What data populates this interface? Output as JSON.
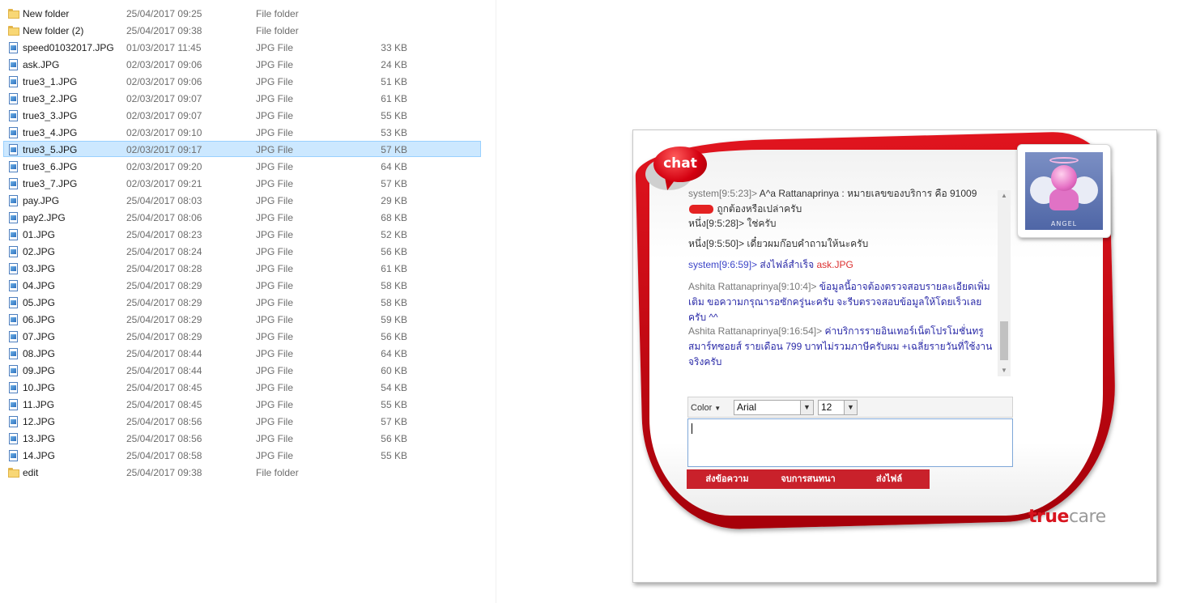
{
  "files": [
    {
      "name": "New folder",
      "date": "25/04/2017 09:25",
      "type": "File folder",
      "size": "",
      "icon": "folder-icon"
    },
    {
      "name": "New folder (2)",
      "date": "25/04/2017 09:38",
      "type": "File folder",
      "size": "",
      "icon": "folder-icon"
    },
    {
      "name": "speed01032017.JPG",
      "date": "01/03/2017 11:45",
      "type": "JPG File",
      "size": "33 KB",
      "icon": "jpg-file-icon"
    },
    {
      "name": "ask.JPG",
      "date": "02/03/2017 09:06",
      "type": "JPG File",
      "size": "24 KB",
      "icon": "jpg-file-icon"
    },
    {
      "name": "true3_1.JPG",
      "date": "02/03/2017 09:06",
      "type": "JPG File",
      "size": "51 KB",
      "icon": "jpg-file-icon"
    },
    {
      "name": "true3_2.JPG",
      "date": "02/03/2017 09:07",
      "type": "JPG File",
      "size": "61 KB",
      "icon": "jpg-file-icon"
    },
    {
      "name": "true3_3.JPG",
      "date": "02/03/2017 09:07",
      "type": "JPG File",
      "size": "55 KB",
      "icon": "jpg-file-icon"
    },
    {
      "name": "true3_4.JPG",
      "date": "02/03/2017 09:10",
      "type": "JPG File",
      "size": "53 KB",
      "icon": "jpg-file-icon"
    },
    {
      "name": "true3_5.JPG",
      "date": "02/03/2017 09:17",
      "type": "JPG File",
      "size": "57 KB",
      "icon": "jpg-file-icon",
      "selected": true
    },
    {
      "name": "true3_6.JPG",
      "date": "02/03/2017 09:20",
      "type": "JPG File",
      "size": "64 KB",
      "icon": "jpg-file-icon"
    },
    {
      "name": "true3_7.JPG",
      "date": "02/03/2017 09:21",
      "type": "JPG File",
      "size": "57 KB",
      "icon": "jpg-file-icon"
    },
    {
      "name": "pay.JPG",
      "date": "25/04/2017 08:03",
      "type": "JPG File",
      "size": "29 KB",
      "icon": "jpg-file-icon"
    },
    {
      "name": "pay2.JPG",
      "date": "25/04/2017 08:06",
      "type": "JPG File",
      "size": "68 KB",
      "icon": "jpg-file-icon"
    },
    {
      "name": "01.JPG",
      "date": "25/04/2017 08:23",
      "type": "JPG File",
      "size": "52 KB",
      "icon": "jpg-file-icon"
    },
    {
      "name": "02.JPG",
      "date": "25/04/2017 08:24",
      "type": "JPG File",
      "size": "56 KB",
      "icon": "jpg-file-icon"
    },
    {
      "name": "03.JPG",
      "date": "25/04/2017 08:28",
      "type": "JPG File",
      "size": "61 KB",
      "icon": "jpg-file-icon"
    },
    {
      "name": "04.JPG",
      "date": "25/04/2017 08:29",
      "type": "JPG File",
      "size": "58 KB",
      "icon": "jpg-file-icon"
    },
    {
      "name": "05.JPG",
      "date": "25/04/2017 08:29",
      "type": "JPG File",
      "size": "58 KB",
      "icon": "jpg-file-icon"
    },
    {
      "name": "06.JPG",
      "date": "25/04/2017 08:29",
      "type": "JPG File",
      "size": "59 KB",
      "icon": "jpg-file-icon"
    },
    {
      "name": "07.JPG",
      "date": "25/04/2017 08:29",
      "type": "JPG File",
      "size": "56 KB",
      "icon": "jpg-file-icon"
    },
    {
      "name": "08.JPG",
      "date": "25/04/2017 08:44",
      "type": "JPG File",
      "size": "64 KB",
      "icon": "jpg-file-icon"
    },
    {
      "name": "09.JPG",
      "date": "25/04/2017 08:44",
      "type": "JPG File",
      "size": "60 KB",
      "icon": "jpg-file-icon"
    },
    {
      "name": "10.JPG",
      "date": "25/04/2017 08:45",
      "type": "JPG File",
      "size": "54 KB",
      "icon": "jpg-file-icon"
    },
    {
      "name": "11.JPG",
      "date": "25/04/2017 08:45",
      "type": "JPG File",
      "size": "55 KB",
      "icon": "jpg-file-icon"
    },
    {
      "name": "12.JPG",
      "date": "25/04/2017 08:56",
      "type": "JPG File",
      "size": "57 KB",
      "icon": "jpg-file-icon"
    },
    {
      "name": "13.JPG",
      "date": "25/04/2017 08:56",
      "type": "JPG File",
      "size": "56 KB",
      "icon": "jpg-file-icon"
    },
    {
      "name": "14.JPG",
      "date": "25/04/2017 08:58",
      "type": "JPG File",
      "size": "55 KB",
      "icon": "jpg-file-icon"
    },
    {
      "name": "edit",
      "date": "25/04/2017 09:38",
      "type": "File folder",
      "size": "",
      "icon": "folder-icon"
    }
  ],
  "chat": {
    "logo_text": "chat",
    "avatar_caption": "ANGEL",
    "messages": [
      {
        "sender": "system[9:5:23]> ",
        "sender_style": "gray",
        "text_before": "A^a Rattanaprinya : หมายเลขของบริการ คือ 91009",
        "redacted": true,
        "text_after": " ถูกต้องหรือเปล่าครับ",
        "text_style": "dark"
      },
      {
        "sender": "หนึ่ง[9:5:28]> ",
        "sender_style": "dark",
        "text_before": "ใช่ครับ",
        "redacted": false,
        "text_after": "",
        "text_style": "dark"
      },
      {
        "sender": "หนึ่ง[9:5:50]> ",
        "sender_style": "dark",
        "text_before": "เดี๋ยวผมก๊อบคำถามให้นะครับ",
        "redacted": false,
        "text_after": "",
        "text_style": "dark"
      },
      {
        "sender": "system[9:6:59]> ",
        "sender_style": "blue",
        "text_before": "ส่งไฟล์สำเร็จ ",
        "redacted": false,
        "text_after": "",
        "text_style": "blue",
        "link": "ask.JPG"
      },
      {
        "sender": "Ashita Rattanaprinya[9:10:4]> ",
        "sender_style": "gray",
        "text_before": "ข้อมูลนี้อาจต้องตรวจสอบรายละเอียดเพิ่มเติม ขอความกรุณารอซักครู่นะครับ จะรีบตรวจสอบข้อมูลให้โดยเร็วเลยครับ ^^",
        "redacted": false,
        "text_after": "",
        "text_style": "blue"
      },
      {
        "sender": "Ashita Rattanaprinya[9:16:54]> ",
        "sender_style": "gray",
        "text_before": "ค่าบริการรายอินเทอร์เน็ตโปรโมชั่นทรูสมาร์ทซอยส์ รายเดือน 799 บาทไม่รวมภาษีครับผม +เฉลี่ยรายวันที่ใช้งานจริงครับ",
        "redacted": false,
        "text_after": "",
        "text_style": "blue"
      }
    ],
    "toolbar": {
      "color_label": "Color",
      "font_value": "Arial",
      "size_value": "12"
    },
    "input": {
      "value": ""
    },
    "buttons": {
      "send": "ส่งข้อความ",
      "end": "จบการสนทนา",
      "file": "ส่งไฟล์"
    },
    "brand": {
      "part1": "true",
      "part2": "care"
    },
    "colors": {
      "accent": "#c9212b",
      "brand_red": "#d8141e",
      "selection": "#cce8ff"
    }
  }
}
